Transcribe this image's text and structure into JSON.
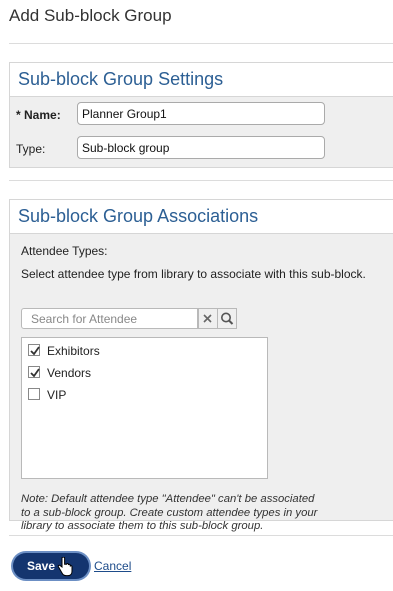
{
  "page": {
    "title": "Add Sub-block Group"
  },
  "settings": {
    "heading": "Sub-block Group Settings",
    "name_label": "* Name:",
    "name_value": "Planner Group1",
    "type_label": "Type:",
    "type_value": "Sub-block group"
  },
  "associations": {
    "heading": "Sub-block Group Associations",
    "attendee_types_label": "Attendee Types:",
    "instruction": "Select attendee type from library to associate with this sub-block.",
    "search_placeholder": "Search for Attendee",
    "items": [
      {
        "label": "Exhibitors",
        "checked": true
      },
      {
        "label": "Vendors",
        "checked": true
      },
      {
        "label": "VIP",
        "checked": false
      }
    ],
    "note_lines": [
      "Note: Default attendee type \"Attendee\" can't be associated",
      "to a sub-block group. Create custom attendee types in your",
      "library to associate them to this sub-block group."
    ]
  },
  "actions": {
    "save_label": "Save",
    "cancel_label": "Cancel"
  },
  "icons": {
    "clear": "close-icon",
    "search": "search-icon",
    "checkbox": "checkmark-icon",
    "cursor": "hand-pointer-icon"
  },
  "colors": {
    "heading": "#2c5f94",
    "save_button": "#14356f",
    "link": "#1e4c8a"
  }
}
